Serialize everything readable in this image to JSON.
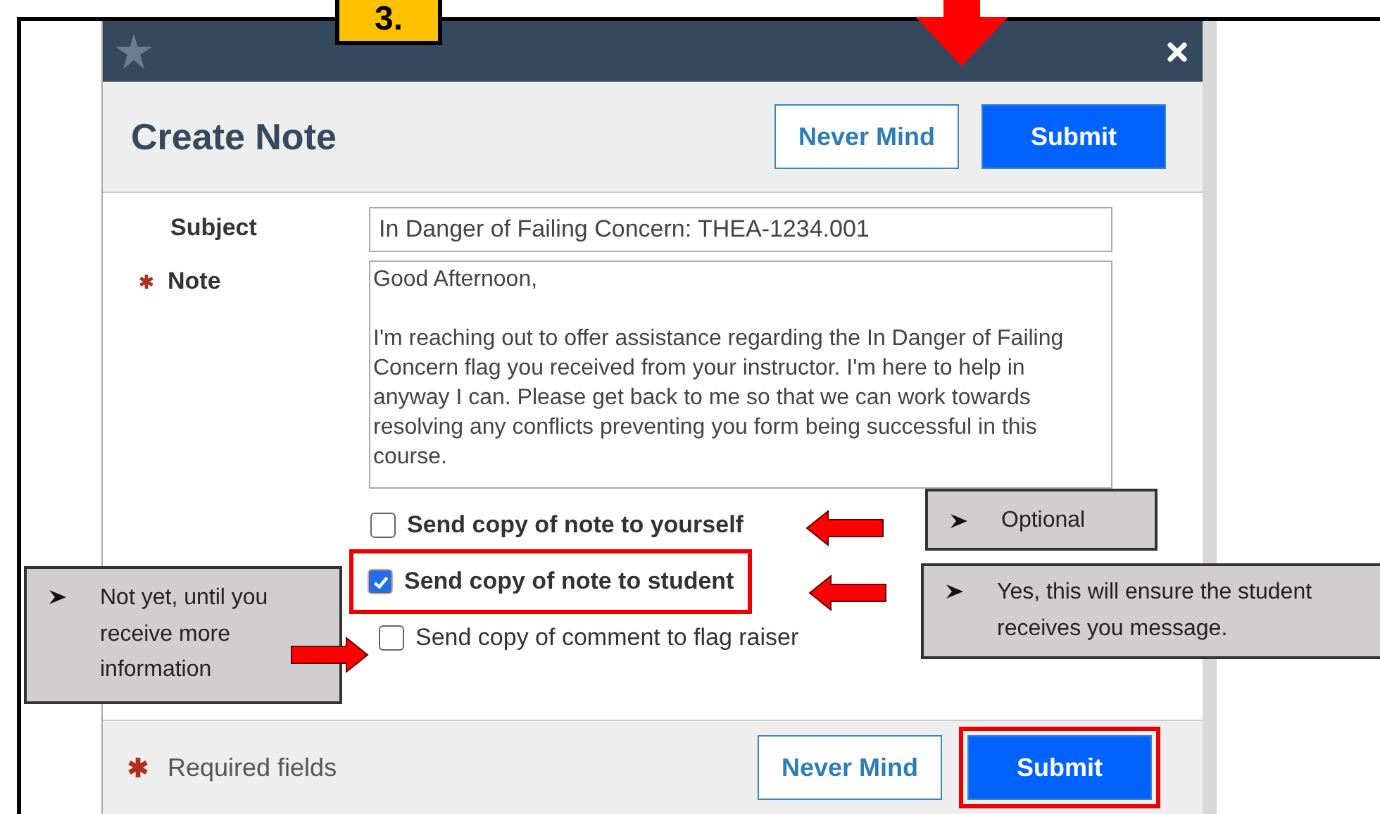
{
  "step_badge": "3.",
  "dialog": {
    "title": "Create Note",
    "header_buttons": [
      {
        "label": "Never Mind",
        "kind": "secondary",
        "highlighted": false
      },
      {
        "label": "Submit",
        "kind": "primary",
        "highlighted": false
      }
    ],
    "subject": {
      "label": "Subject",
      "value": "In Danger of Failing Concern: THEA-1234.001"
    },
    "note": {
      "label": "Note",
      "required": true,
      "value": "Good Afternoon,\n\nI'm reaching out to offer assistance regarding the In Danger of Failing Concern flag you received from your instructor. I'm here to help in anyway I can. Please get back to me so that we can work towards resolving any conflicts preventing you form being successful in this course."
    },
    "checkboxes": [
      {
        "label": "Send copy of note to yourself",
        "checked": false,
        "highlighted": false
      },
      {
        "label": "Send copy of note to student",
        "checked": true,
        "highlighted": true
      },
      {
        "label": "Send copy of comment to flag raiser",
        "checked": false,
        "highlighted": false
      }
    ],
    "footer": {
      "required_note": "Required fields",
      "buttons": [
        {
          "label": "Never Mind",
          "kind": "secondary",
          "highlighted": false
        },
        {
          "label": "Submit",
          "kind": "primary",
          "highlighted": true
        }
      ]
    }
  },
  "callouts": [
    {
      "text": "Optional"
    },
    {
      "text": "Not yet, until you receive more information"
    },
    {
      "text": "Yes, this will ensure the student receives you message."
    }
  ]
}
